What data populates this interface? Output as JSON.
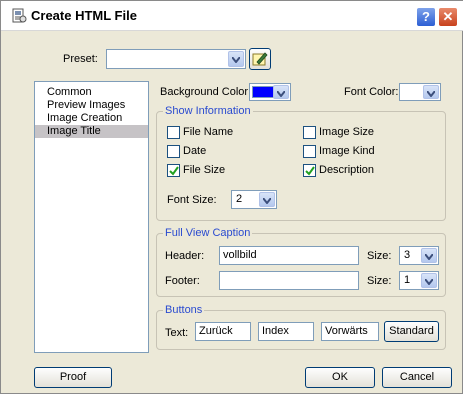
{
  "titlebar": {
    "title": "Create HTML File",
    "help_glyph": "?",
    "close_glyph": "✕"
  },
  "preset": {
    "label": "Preset:",
    "value": ""
  },
  "sidebar": {
    "items": [
      {
        "label": "Common"
      },
      {
        "label": "Preview Images"
      },
      {
        "label": "Image Creation"
      },
      {
        "label": "Image Title",
        "selected": true
      }
    ]
  },
  "colors": {
    "background_label": "Background Color:",
    "background_color": "#0000ff",
    "font_label": "Font Color:",
    "font_color": "#ffffff"
  },
  "show_info": {
    "title": "Show Information",
    "file_name": {
      "label": "File Name",
      "checked": false
    },
    "image_size": {
      "label": "Image Size",
      "checked": false
    },
    "date": {
      "label": "Date",
      "checked": false
    },
    "image_kind": {
      "label": "Image Kind",
      "checked": false
    },
    "file_size": {
      "label": "File Size",
      "checked": true
    },
    "description": {
      "label": "Description",
      "checked": true
    },
    "font_size_label": "Font Size:",
    "font_size_value": "2"
  },
  "caption": {
    "title": "Full View Caption",
    "header_label": "Header:",
    "header_value": "vollbild",
    "header_size_label": "Size:",
    "header_size": "3",
    "footer_label": "Footer:",
    "footer_value": "",
    "footer_size_label": "Size:",
    "footer_size": "1"
  },
  "buttons_group": {
    "title": "Buttons",
    "text_label": "Text:",
    "back": "Zurück",
    "index": "Index",
    "forward": "Vorwärts",
    "standard": "Standard"
  },
  "footer": {
    "proof": "Proof",
    "ok": "OK",
    "cancel": "Cancel"
  }
}
